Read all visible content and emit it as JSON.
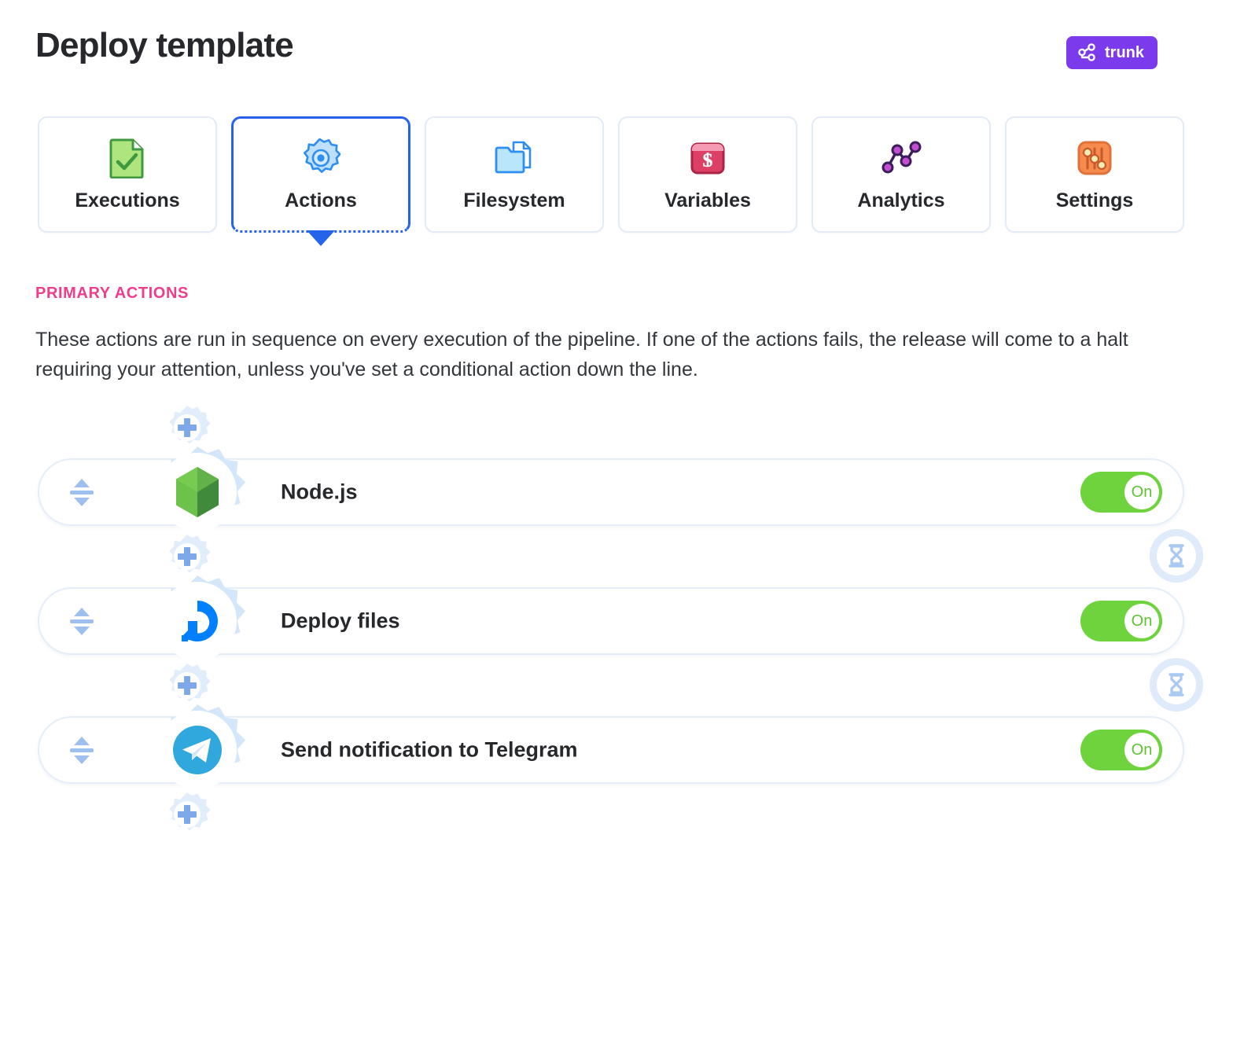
{
  "header": {
    "title": "Deploy template",
    "branch_badge": {
      "label": "trunk",
      "icon": "git-branch-icon",
      "color": "#7c3aed"
    }
  },
  "tabs": [
    {
      "label": "Executions",
      "icon": "document-check-icon",
      "active": false
    },
    {
      "label": "Actions",
      "icon": "gear-icon",
      "active": true
    },
    {
      "label": "Filesystem",
      "icon": "folder-file-icon",
      "active": false
    },
    {
      "label": "Variables",
      "icon": "dollar-window-icon",
      "active": false
    },
    {
      "label": "Analytics",
      "icon": "line-chart-icon",
      "active": false
    },
    {
      "label": "Settings",
      "icon": "sliders-icon",
      "active": false
    }
  ],
  "section": {
    "title": "PRIMARY ACTIONS",
    "title_color": "#ee3d8b",
    "description": "These actions are run in sequence on every execution of the pipeline. If one of the actions fails, the release will come to a halt requiring your attention, unless you've set a conditional action down the line."
  },
  "pipeline": {
    "add_action_icon": "add-action-gear-icon",
    "wait_icon": "hourglass-icon",
    "sort_icon": "sort-handle-icon",
    "actions": [
      {
        "name": "Node.js",
        "icon": "nodejs-icon",
        "toggle": "On",
        "enabled": true
      },
      {
        "name": "Deploy files",
        "icon": "digitalocean-icon",
        "toggle": "On",
        "enabled": true
      },
      {
        "name": "Send notification to Telegram",
        "icon": "telegram-icon",
        "toggle": "On",
        "enabled": true
      }
    ],
    "toggle_on_color": "#6ed33c"
  }
}
